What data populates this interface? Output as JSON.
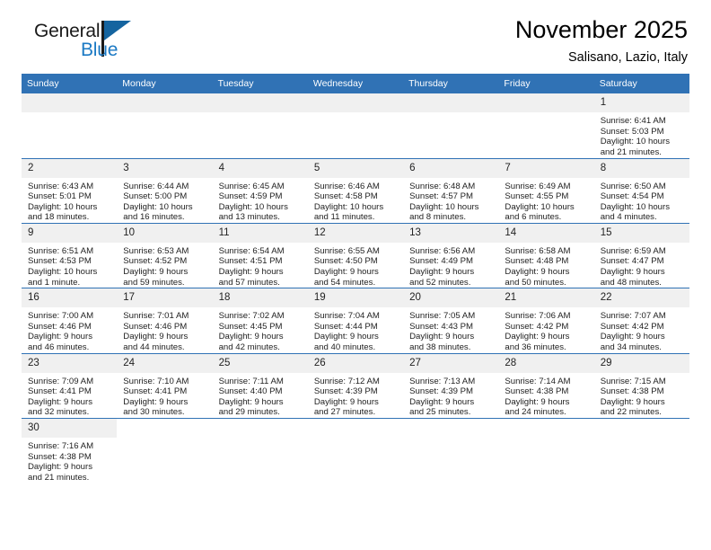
{
  "brand": {
    "name_part1": "General",
    "name_part2": "Blue",
    "flag_color": "#15649f",
    "blue_text_color": "#1b79c4"
  },
  "header": {
    "title": "November 2025",
    "subtitle": "Salisano, Lazio, Italy"
  },
  "theme": {
    "header_blue": "#3072B5",
    "daynum_band": "#F0F0F0",
    "cell_background": "#FFFFFF",
    "text": "#222222"
  },
  "weekdays": [
    "Sunday",
    "Monday",
    "Tuesday",
    "Wednesday",
    "Thursday",
    "Friday",
    "Saturday"
  ],
  "weeks": [
    [
      {
        "day": "",
        "sunrise": "",
        "sunset": "",
        "daylight1": "",
        "daylight2": "",
        "type": "blank"
      },
      {
        "day": "",
        "sunrise": "",
        "sunset": "",
        "daylight1": "",
        "daylight2": "",
        "type": "blank"
      },
      {
        "day": "",
        "sunrise": "",
        "sunset": "",
        "daylight1": "",
        "daylight2": "",
        "type": "blank"
      },
      {
        "day": "",
        "sunrise": "",
        "sunset": "",
        "daylight1": "",
        "daylight2": "",
        "type": "blank"
      },
      {
        "day": "",
        "sunrise": "",
        "sunset": "",
        "daylight1": "",
        "daylight2": "",
        "type": "blank"
      },
      {
        "day": "",
        "sunrise": "",
        "sunset": "",
        "daylight1": "",
        "daylight2": "",
        "type": "blank"
      },
      {
        "day": "1",
        "sunrise": "Sunrise: 6:41 AM",
        "sunset": "Sunset: 5:03 PM",
        "daylight1": "Daylight: 10 hours",
        "daylight2": "and 21 minutes.",
        "type": "day"
      }
    ],
    [
      {
        "day": "2",
        "sunrise": "Sunrise: 6:43 AM",
        "sunset": "Sunset: 5:01 PM",
        "daylight1": "Daylight: 10 hours",
        "daylight2": "and 18 minutes.",
        "type": "day"
      },
      {
        "day": "3",
        "sunrise": "Sunrise: 6:44 AM",
        "sunset": "Sunset: 5:00 PM",
        "daylight1": "Daylight: 10 hours",
        "daylight2": "and 16 minutes.",
        "type": "day"
      },
      {
        "day": "4",
        "sunrise": "Sunrise: 6:45 AM",
        "sunset": "Sunset: 4:59 PM",
        "daylight1": "Daylight: 10 hours",
        "daylight2": "and 13 minutes.",
        "type": "day"
      },
      {
        "day": "5",
        "sunrise": "Sunrise: 6:46 AM",
        "sunset": "Sunset: 4:58 PM",
        "daylight1": "Daylight: 10 hours",
        "daylight2": "and 11 minutes.",
        "type": "day"
      },
      {
        "day": "6",
        "sunrise": "Sunrise: 6:48 AM",
        "sunset": "Sunset: 4:57 PM",
        "daylight1": "Daylight: 10 hours",
        "daylight2": "and 8 minutes.",
        "type": "day"
      },
      {
        "day": "7",
        "sunrise": "Sunrise: 6:49 AM",
        "sunset": "Sunset: 4:55 PM",
        "daylight1": "Daylight: 10 hours",
        "daylight2": "and 6 minutes.",
        "type": "day"
      },
      {
        "day": "8",
        "sunrise": "Sunrise: 6:50 AM",
        "sunset": "Sunset: 4:54 PM",
        "daylight1": "Daylight: 10 hours",
        "daylight2": "and 4 minutes.",
        "type": "day"
      }
    ],
    [
      {
        "day": "9",
        "sunrise": "Sunrise: 6:51 AM",
        "sunset": "Sunset: 4:53 PM",
        "daylight1": "Daylight: 10 hours",
        "daylight2": "and 1 minute.",
        "type": "day"
      },
      {
        "day": "10",
        "sunrise": "Sunrise: 6:53 AM",
        "sunset": "Sunset: 4:52 PM",
        "daylight1": "Daylight: 9 hours",
        "daylight2": "and 59 minutes.",
        "type": "day"
      },
      {
        "day": "11",
        "sunrise": "Sunrise: 6:54 AM",
        "sunset": "Sunset: 4:51 PM",
        "daylight1": "Daylight: 9 hours",
        "daylight2": "and 57 minutes.",
        "type": "day"
      },
      {
        "day": "12",
        "sunrise": "Sunrise: 6:55 AM",
        "sunset": "Sunset: 4:50 PM",
        "daylight1": "Daylight: 9 hours",
        "daylight2": "and 54 minutes.",
        "type": "day"
      },
      {
        "day": "13",
        "sunrise": "Sunrise: 6:56 AM",
        "sunset": "Sunset: 4:49 PM",
        "daylight1": "Daylight: 9 hours",
        "daylight2": "and 52 minutes.",
        "type": "day"
      },
      {
        "day": "14",
        "sunrise": "Sunrise: 6:58 AM",
        "sunset": "Sunset: 4:48 PM",
        "daylight1": "Daylight: 9 hours",
        "daylight2": "and 50 minutes.",
        "type": "day"
      },
      {
        "day": "15",
        "sunrise": "Sunrise: 6:59 AM",
        "sunset": "Sunset: 4:47 PM",
        "daylight1": "Daylight: 9 hours",
        "daylight2": "and 48 minutes.",
        "type": "day"
      }
    ],
    [
      {
        "day": "16",
        "sunrise": "Sunrise: 7:00 AM",
        "sunset": "Sunset: 4:46 PM",
        "daylight1": "Daylight: 9 hours",
        "daylight2": "and 46 minutes.",
        "type": "day"
      },
      {
        "day": "17",
        "sunrise": "Sunrise: 7:01 AM",
        "sunset": "Sunset: 4:46 PM",
        "daylight1": "Daylight: 9 hours",
        "daylight2": "and 44 minutes.",
        "type": "day"
      },
      {
        "day": "18",
        "sunrise": "Sunrise: 7:02 AM",
        "sunset": "Sunset: 4:45 PM",
        "daylight1": "Daylight: 9 hours",
        "daylight2": "and 42 minutes.",
        "type": "day"
      },
      {
        "day": "19",
        "sunrise": "Sunrise: 7:04 AM",
        "sunset": "Sunset: 4:44 PM",
        "daylight1": "Daylight: 9 hours",
        "daylight2": "and 40 minutes.",
        "type": "day"
      },
      {
        "day": "20",
        "sunrise": "Sunrise: 7:05 AM",
        "sunset": "Sunset: 4:43 PM",
        "daylight1": "Daylight: 9 hours",
        "daylight2": "and 38 minutes.",
        "type": "day"
      },
      {
        "day": "21",
        "sunrise": "Sunrise: 7:06 AM",
        "sunset": "Sunset: 4:42 PM",
        "daylight1": "Daylight: 9 hours",
        "daylight2": "and 36 minutes.",
        "type": "day"
      },
      {
        "day": "22",
        "sunrise": "Sunrise: 7:07 AM",
        "sunset": "Sunset: 4:42 PM",
        "daylight1": "Daylight: 9 hours",
        "daylight2": "and 34 minutes.",
        "type": "day"
      }
    ],
    [
      {
        "day": "23",
        "sunrise": "Sunrise: 7:09 AM",
        "sunset": "Sunset: 4:41 PM",
        "daylight1": "Daylight: 9 hours",
        "daylight2": "and 32 minutes.",
        "type": "day"
      },
      {
        "day": "24",
        "sunrise": "Sunrise: 7:10 AM",
        "sunset": "Sunset: 4:41 PM",
        "daylight1": "Daylight: 9 hours",
        "daylight2": "and 30 minutes.",
        "type": "day"
      },
      {
        "day": "25",
        "sunrise": "Sunrise: 7:11 AM",
        "sunset": "Sunset: 4:40 PM",
        "daylight1": "Daylight: 9 hours",
        "daylight2": "and 29 minutes.",
        "type": "day"
      },
      {
        "day": "26",
        "sunrise": "Sunrise: 7:12 AM",
        "sunset": "Sunset: 4:39 PM",
        "daylight1": "Daylight: 9 hours",
        "daylight2": "and 27 minutes.",
        "type": "day"
      },
      {
        "day": "27",
        "sunrise": "Sunrise: 7:13 AM",
        "sunset": "Sunset: 4:39 PM",
        "daylight1": "Daylight: 9 hours",
        "daylight2": "and 25 minutes.",
        "type": "day"
      },
      {
        "day": "28",
        "sunrise": "Sunrise: 7:14 AM",
        "sunset": "Sunset: 4:38 PM",
        "daylight1": "Daylight: 9 hours",
        "daylight2": "and 24 minutes.",
        "type": "day"
      },
      {
        "day": "29",
        "sunrise": "Sunrise: 7:15 AM",
        "sunset": "Sunset: 4:38 PM",
        "daylight1": "Daylight: 9 hours",
        "daylight2": "and 22 minutes.",
        "type": "day"
      }
    ],
    [
      {
        "day": "30",
        "sunrise": "Sunrise: 7:16 AM",
        "sunset": "Sunset: 4:38 PM",
        "daylight1": "Daylight: 9 hours",
        "daylight2": "and 21 minutes.",
        "type": "day"
      },
      {
        "day": "",
        "sunrise": "",
        "sunset": "",
        "daylight1": "",
        "daylight2": "",
        "type": "void"
      },
      {
        "day": "",
        "sunrise": "",
        "sunset": "",
        "daylight1": "",
        "daylight2": "",
        "type": "void"
      },
      {
        "day": "",
        "sunrise": "",
        "sunset": "",
        "daylight1": "",
        "daylight2": "",
        "type": "void"
      },
      {
        "day": "",
        "sunrise": "",
        "sunset": "",
        "daylight1": "",
        "daylight2": "",
        "type": "void"
      },
      {
        "day": "",
        "sunrise": "",
        "sunset": "",
        "daylight1": "",
        "daylight2": "",
        "type": "void"
      },
      {
        "day": "",
        "sunrise": "",
        "sunset": "",
        "daylight1": "",
        "daylight2": "",
        "type": "void"
      }
    ]
  ]
}
